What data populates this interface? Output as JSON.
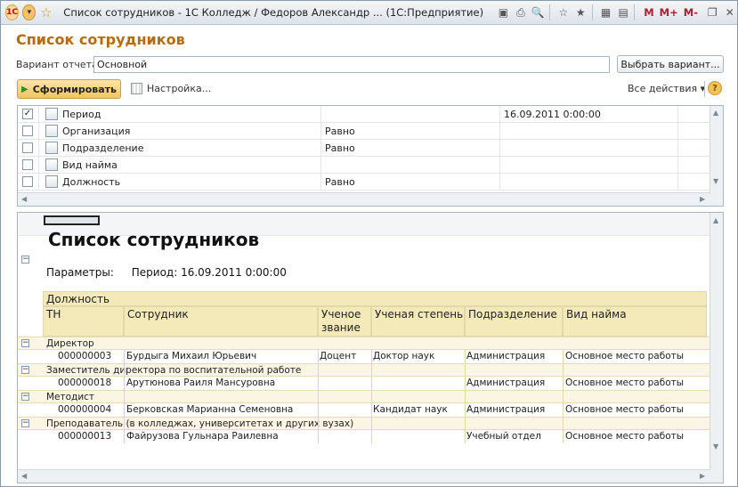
{
  "window": {
    "title": "Список сотрудников - 1С Колледж / Федоров Александр ... (1С:Предприятие)",
    "m_labels": [
      "M",
      "M+",
      "M-"
    ],
    "logo_text": "1С"
  },
  "page": {
    "title": "Список сотрудников",
    "variant_label": "Вариант отчета:",
    "variant_value": "Основной",
    "choose_variant_btn": "Выбрать вариант...",
    "generate_btn": "Сформировать",
    "settings_label": "Настройка...",
    "all_actions": "Все действия",
    "help": "?"
  },
  "filters": [
    {
      "checked": true,
      "name": "Период",
      "condition": "",
      "value": "16.09.2011 0:00:00"
    },
    {
      "checked": false,
      "name": "Организация",
      "condition": "Равно",
      "value": ""
    },
    {
      "checked": false,
      "name": "Подразделение",
      "condition": "Равно",
      "value": ""
    },
    {
      "checked": false,
      "name": "Вид найма",
      "condition": "",
      "value": ""
    },
    {
      "checked": false,
      "name": "Должность",
      "condition": "Равно",
      "value": ""
    }
  ],
  "report": {
    "title": "Список сотрудников",
    "params_label": "Параметры:",
    "params_value": "Период: 16.09.2011 0:00:00",
    "group_header": "Должность",
    "columns": [
      "ТН",
      "Сотрудник",
      "Ученое звание",
      "Ученая степень",
      "Подразделение",
      "Вид найма"
    ],
    "groups": [
      {
        "name": "Директор",
        "rows": [
          {
            "tn": "000000003",
            "name": "Бурдыга Михаил Юрьевич",
            "title": "Доцент",
            "degree": "Доктор наук",
            "dept": "Администрация",
            "hire": "Основное место работы"
          }
        ]
      },
      {
        "name": "Заместитель директора по воспитательной работе",
        "rows": [
          {
            "tn": "000000018",
            "name": "Арутюнова Раиля Мансуровна",
            "title": "",
            "degree": "",
            "dept": "Администрация",
            "hire": "Основное место работы"
          }
        ]
      },
      {
        "name": "Методист",
        "rows": [
          {
            "tn": "000000004",
            "name": "Берковская Марианна Семеновна",
            "title": "",
            "degree": "Кандидат наук",
            "dept": "Администрация",
            "hire": "Основное место работы"
          }
        ]
      },
      {
        "name": "Преподаватель (в колледжах, университетах и других вузах)",
        "rows": [
          {
            "tn": "000000013",
            "name": "Файрузова Гульнара Раилевна",
            "title": "",
            "degree": "",
            "dept": "Учебный отдел",
            "hire": "Основное место работы"
          }
        ]
      }
    ]
  }
}
